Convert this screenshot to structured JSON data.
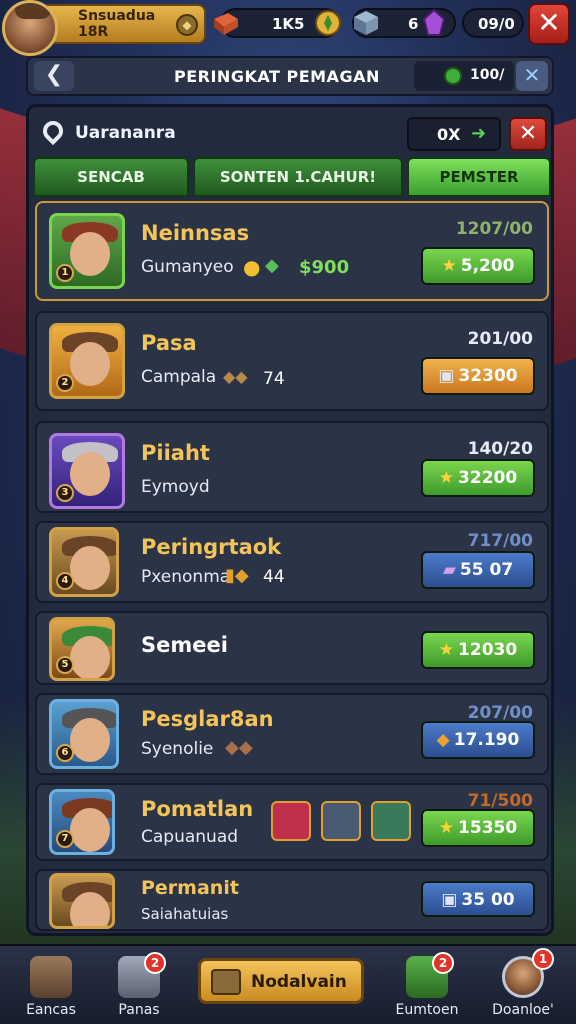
{
  "top": {
    "player_name": "Snsuadua",
    "player_level": "18R",
    "res1": "1K5",
    "res2": "6",
    "res3": "09/0",
    "close_label": "✕"
  },
  "header": {
    "back_label": "❮",
    "title": "PERINGKAT PEMAGAN",
    "coins": "100/",
    "close_label": "✕"
  },
  "panel": {
    "search_text": "Uarananra",
    "ox_text": "0X",
    "close_label": "✕"
  },
  "tabs": [
    {
      "label": "SENCAB"
    },
    {
      "label": "SONTEN 1.CAHUR!"
    },
    {
      "label": "PEMSTER"
    }
  ],
  "rows": [
    {
      "name": "Neinnsas",
      "sub": "Gumanyeo",
      "extra": "$900",
      "score": "1207/00",
      "btn": "5,200"
    },
    {
      "name": "Pasa",
      "sub": "Campala",
      "extra": "74",
      "score": "201/00",
      "btn": "32300"
    },
    {
      "name": "Piiaht",
      "sub": "Eymoyd",
      "extra": "",
      "score": "140/20",
      "btn": "32200"
    },
    {
      "name": "Peringrtaok",
      "sub": "Pxenonma",
      "extra": "44",
      "score": "717/00",
      "btn": "55 07"
    },
    {
      "name": "Semeei",
      "sub": "",
      "extra": "",
      "score": "",
      "btn": "12030"
    },
    {
      "name": "Pesglar8an",
      "sub": "Syenolie",
      "extra": "",
      "score": "207/00",
      "btn": "17.190"
    },
    {
      "name": "Pomatlan",
      "sub": "Capuanuad",
      "extra": "",
      "score": "71/500",
      "btn": "15350"
    },
    {
      "name": "Permanit",
      "sub": "Saiahatuias",
      "extra": "",
      "score": "",
      "btn": "35 00"
    }
  ],
  "nav": {
    "item1": "Eancas",
    "item2": "Panas",
    "center": "Nodalvain",
    "item4": "Eumtoen",
    "item5": "Doanloe'",
    "badge2": "2",
    "badge4": "2",
    "badge5": "1"
  },
  "colors": {
    "accent_green": "#5bd15a",
    "gold": "#f3c45a",
    "danger": "#e2453a"
  }
}
